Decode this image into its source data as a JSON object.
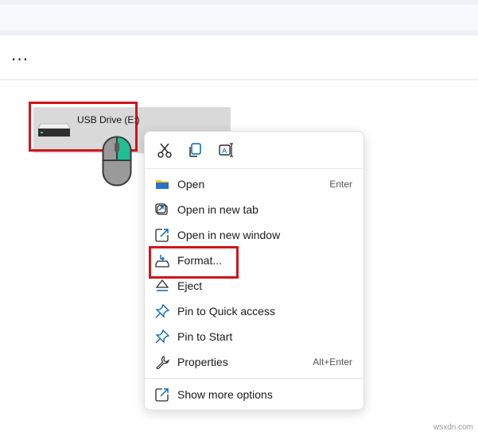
{
  "toolbar": {
    "more_label": "..."
  },
  "drive": {
    "label": "USB Drive (E:)"
  },
  "context_menu": {
    "quick_actions": [
      {
        "icon": "cut-icon"
      },
      {
        "icon": "copy-icon"
      },
      {
        "icon": "rename-icon"
      }
    ],
    "items": [
      {
        "label": "Open",
        "shortcut": "Enter",
        "icon": "folder-icon"
      },
      {
        "label": "Open in new tab",
        "shortcut": "",
        "icon": "open-new-tab-icon"
      },
      {
        "label": "Open in new window",
        "shortcut": "",
        "icon": "open-new-window-icon"
      },
      {
        "label": "Format...",
        "shortcut": "",
        "icon": "format-icon"
      },
      {
        "label": "Eject",
        "shortcut": "",
        "icon": "eject-icon"
      },
      {
        "label": "Pin to Quick access",
        "shortcut": "",
        "icon": "pin-icon"
      },
      {
        "label": "Pin to Start",
        "shortcut": "",
        "icon": "pin-icon"
      },
      {
        "label": "Properties",
        "shortcut": "Alt+Enter",
        "icon": "wrench-icon"
      }
    ],
    "more_options": {
      "label": "Show more options",
      "icon": "show-more-options-icon"
    }
  },
  "watermark": "wsxdn.com",
  "colors": {
    "highlight": "#d0141c",
    "accent": "#0067c0"
  }
}
